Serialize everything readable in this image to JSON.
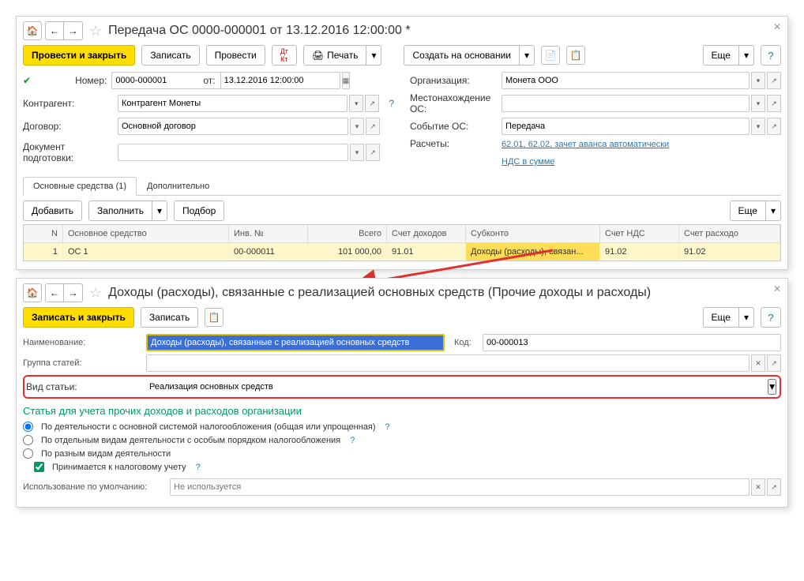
{
  "panel1": {
    "title": "Передача ОС 0000-000001 от 13.12.2016 12:00:00 *",
    "primary_btn": "Провести и закрыть",
    "btn_write": "Записать",
    "btn_post": "Провести",
    "btn_print": "Печать",
    "btn_create_based": "Создать на основании",
    "btn_more": "Еще",
    "labels": {
      "number": "Номер:",
      "from": "от:",
      "org": "Организация:",
      "contragent": "Контрагент:",
      "location": "Местонахождение ОС:",
      "contract": "Договор:",
      "event": "Событие ОС:",
      "prepdoc": "Документ подготовки:",
      "calc": "Расчеты:"
    },
    "values": {
      "number": "0000-000001",
      "date": "13.12.2016 12:00:00",
      "org": "Монета ООО",
      "contragent": "Контрагент Монеты",
      "contract": "Основной договор",
      "event": "Передача"
    },
    "link1": "62.01, 62.02, зачет аванса автоматически",
    "link2": "НДС в сумме",
    "tabs": {
      "main": "Основные средства (1)",
      "extra": "Дополнительно"
    },
    "table_toolbar": {
      "add": "Добавить",
      "fill": "Заполнить",
      "select": "Подбор",
      "more": "Еще"
    },
    "headers": {
      "n": "N",
      "os": "Основное средство",
      "inv": "Инв. №",
      "total": "Всего",
      "acc": "Счет доходов",
      "sub": "Субконто",
      "nds": "Счет НДС",
      "exp": "Счет расходо"
    },
    "row": {
      "n": "1",
      "os": "ОС 1",
      "inv": "00-000011",
      "total": "101 000,00",
      "acc": "91.01",
      "sub": "Доходы (расходы), связан...",
      "nds": "91.02",
      "exp": "91.02"
    }
  },
  "panel2": {
    "title": "Доходы (расходы), связанные с реализацией основных средств (Прочие доходы и расходы)",
    "primary_btn": "Записать и закрыть",
    "btn_write": "Записать",
    "btn_more": "Еще",
    "labels": {
      "name": "Наименование:",
      "group": "Группа статей:",
      "type": "Вид статьи:",
      "code": "Код:",
      "usage": "Использование по умолчанию:"
    },
    "values": {
      "name": "Доходы (расходы), связанные с реализацией основных средств",
      "code": "00-000013",
      "type": "Реализация основных средств",
      "usage_placeholder": "Не используется"
    },
    "section": "Статья для учета прочих доходов и расходов организации",
    "radios": {
      "r1": "По деятельности с основной системой налогообложения (общая или упрощенная)",
      "r2": "По отдельным видам деятельности с особым порядком налогообложения",
      "r3": "По разным видам деятельности"
    },
    "checkbox": "Принимается к налоговому учету"
  }
}
